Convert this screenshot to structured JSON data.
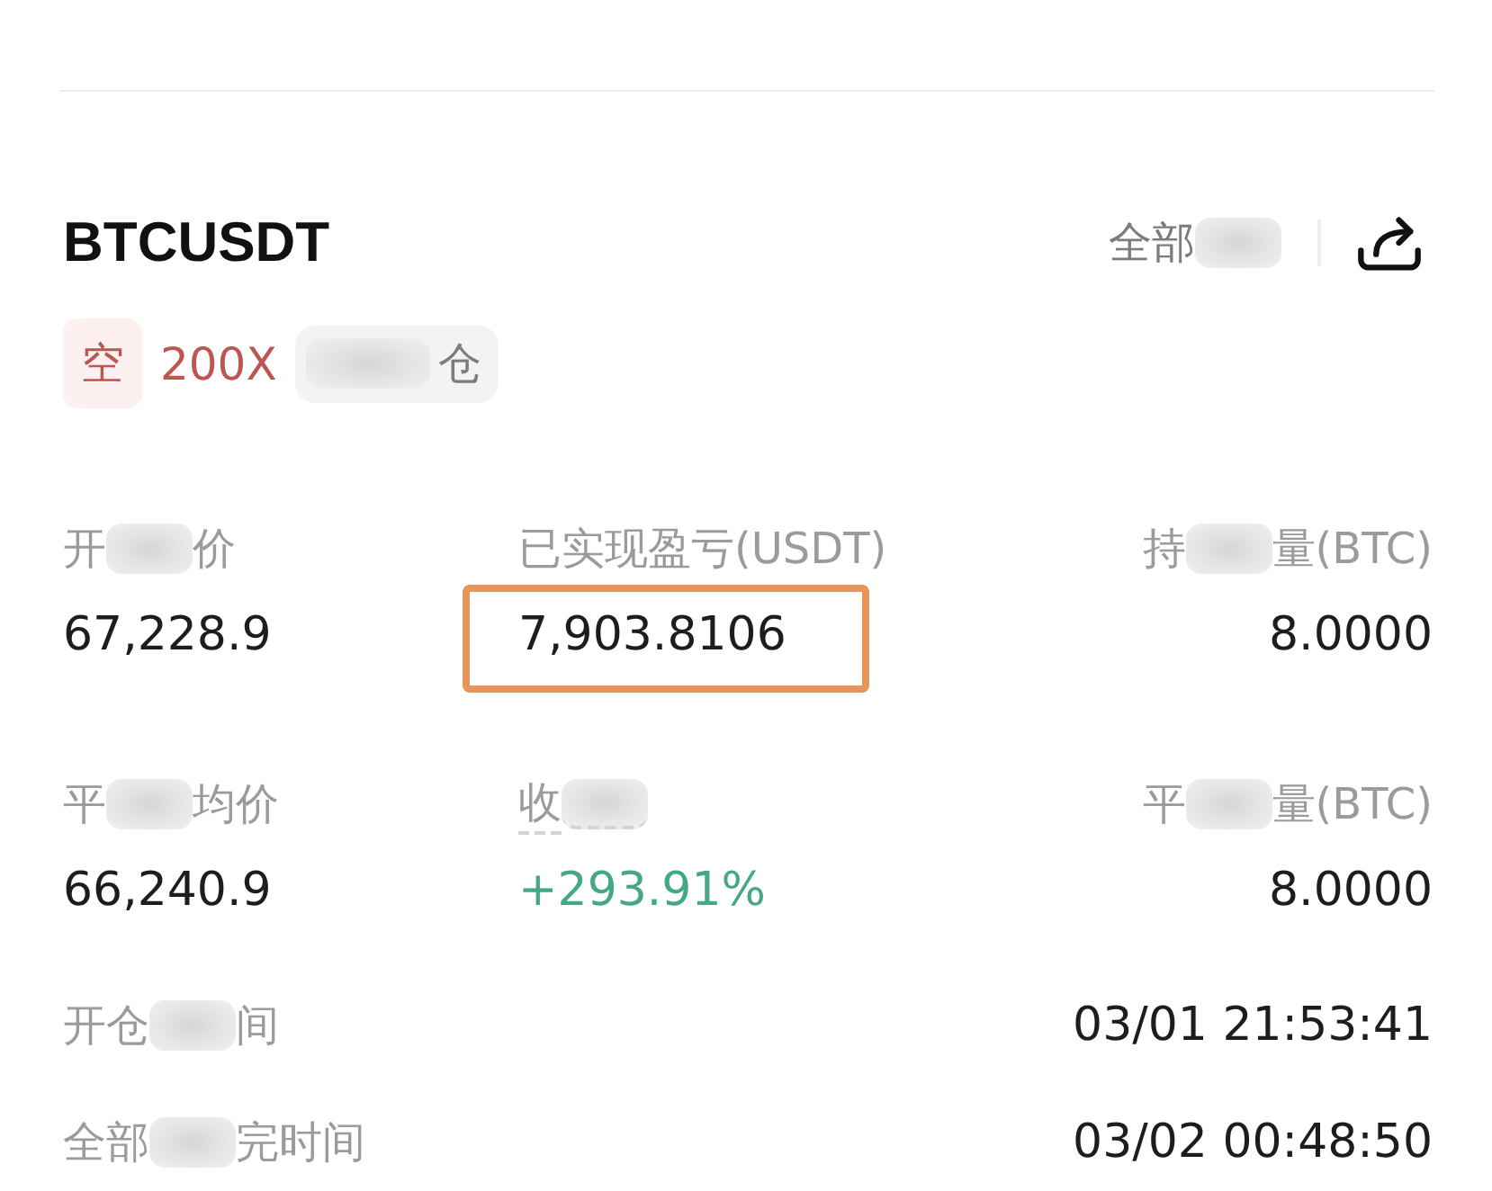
{
  "header": {
    "symbol": "BTCUSDT",
    "close_all": [
      {
        "kind": "text",
        "text": "全部"
      },
      {
        "kind": "blur"
      }
    ]
  },
  "tags": {
    "short": true,
    "side_label": "空",
    "leverage": "200X",
    "margin_mode": [
      {
        "kind": "blur"
      },
      {
        "kind": "text",
        "text": "仓"
      }
    ]
  },
  "stats": [
    {
      "label": [
        {
          "kind": "text",
          "text": "开"
        },
        {
          "kind": "blur"
        },
        {
          "kind": "text",
          "text": "价"
        }
      ],
      "underlined": false,
      "value": "67,228.9",
      "positive": false,
      "highlighted": false
    },
    {
      "label": [
        {
          "kind": "text",
          "text": "已实现盈亏(USDT)"
        }
      ],
      "underlined": false,
      "value": "7,903.8106",
      "positive": false,
      "highlighted": true
    },
    {
      "label": [
        {
          "kind": "text",
          "text": "持"
        },
        {
          "kind": "blur"
        },
        {
          "kind": "text",
          "text": "量(BTC)"
        }
      ],
      "underlined": false,
      "value": "8.0000",
      "positive": false,
      "highlighted": false
    },
    {
      "label": [
        {
          "kind": "text",
          "text": "平"
        },
        {
          "kind": "blur"
        },
        {
          "kind": "text",
          "text": "均价"
        }
      ],
      "underlined": false,
      "value": "66,240.9",
      "positive": false,
      "highlighted": false
    },
    {
      "label": [
        {
          "kind": "text",
          "text": "收"
        },
        {
          "kind": "blur"
        }
      ],
      "underlined": true,
      "value": "+293.91%",
      "positive": true,
      "highlighted": false
    },
    {
      "label": [
        {
          "kind": "text",
          "text": "平"
        },
        {
          "kind": "blur"
        },
        {
          "kind": "text",
          "text": "量(BTC)"
        }
      ],
      "underlined": false,
      "value": "8.0000",
      "positive": false,
      "highlighted": false
    }
  ],
  "details": [
    {
      "label": [
        {
          "kind": "text",
          "text": "开仓"
        },
        {
          "kind": "blur"
        },
        {
          "kind": "text",
          "text": "间"
        }
      ],
      "value": "03/01 21:53:41"
    },
    {
      "label": [
        {
          "kind": "text",
          "text": "全部"
        },
        {
          "kind": "blur"
        },
        {
          "kind": "text",
          "text": "完时间"
        }
      ],
      "value": "03/02 00:48:50"
    }
  ]
}
